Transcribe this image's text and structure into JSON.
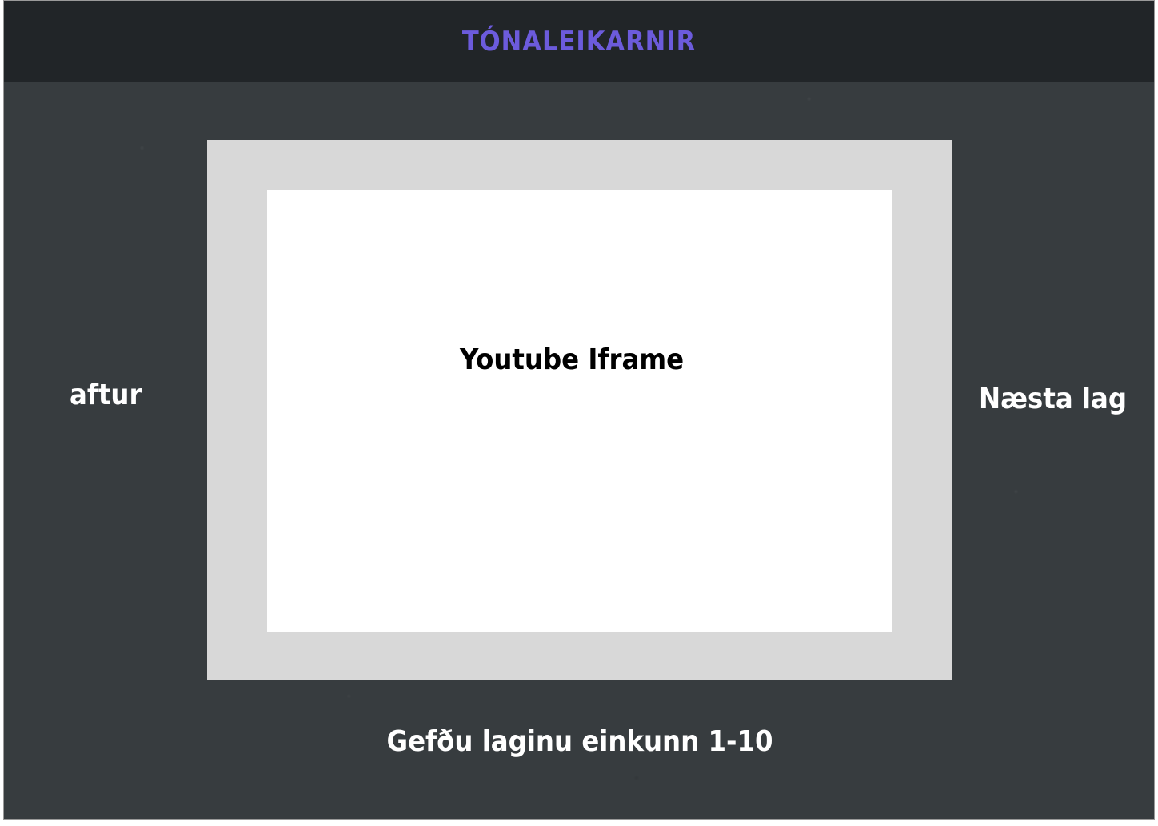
{
  "header": {
    "title": "TÓNALEIKARNIR"
  },
  "player": {
    "placeholder_label": "Youtube Iframe"
  },
  "navigation": {
    "previous_label": "aftur",
    "next_label": "Næsta lag"
  },
  "rating": {
    "prompt": "Gefðu laginu einkunn 1-10"
  },
  "colors": {
    "title_accent": "#6c5bdc",
    "header_background": "#212528",
    "page_background": "#373c3f",
    "player_frame": "#d8d8d8",
    "player_screen": "#ffffff"
  }
}
